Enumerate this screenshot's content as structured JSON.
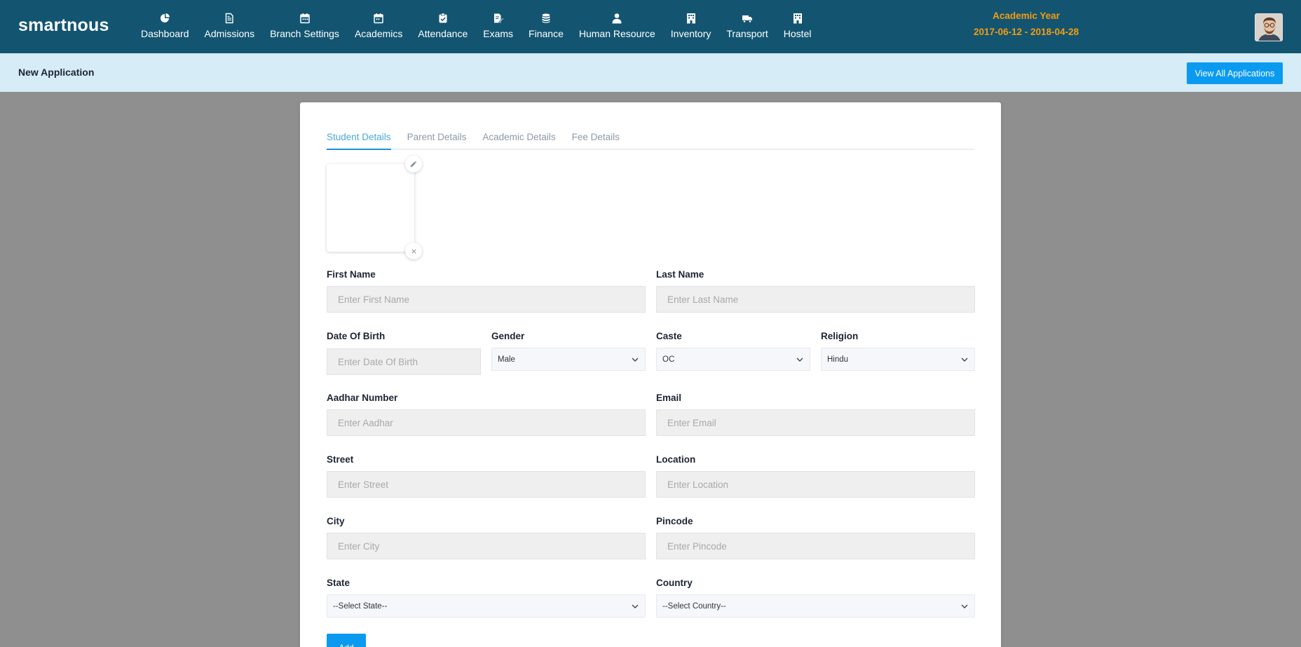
{
  "app": {
    "brand": "smartnous"
  },
  "nav": {
    "items": [
      {
        "label": "Dashboard",
        "icon": "pie-chart-icon"
      },
      {
        "label": "Admissions",
        "icon": "document-icon"
      },
      {
        "label": "Branch Settings",
        "icon": "calendar-icon"
      },
      {
        "label": "Academics",
        "icon": "calendar-icon"
      },
      {
        "label": "Attendance",
        "icon": "clipboard-check-icon"
      },
      {
        "label": "Exams",
        "icon": "edit-document-icon"
      },
      {
        "label": "Finance",
        "icon": "coins-icon"
      },
      {
        "label": "Human Resource",
        "icon": "user-icon"
      },
      {
        "label": "Inventory",
        "icon": "building-icon"
      },
      {
        "label": "Transport",
        "icon": "truck-icon"
      },
      {
        "label": "Hostel",
        "icon": "building-icon"
      }
    ]
  },
  "academic_year": {
    "label": "Academic Year",
    "range": "2017-06-12 - 2018-04-28",
    "color": "#f39c12"
  },
  "subheader": {
    "title": "New Application",
    "view_all_label": "View All Applications"
  },
  "tabs": [
    {
      "label": "Student Details",
      "active": true
    },
    {
      "label": "Parent Details",
      "active": false
    },
    {
      "label": "Academic Details",
      "active": false
    },
    {
      "label": "Fee Details",
      "active": false
    }
  ],
  "form": {
    "first_name": {
      "label": "First Name",
      "placeholder": "Enter First Name"
    },
    "last_name": {
      "label": "Last Name",
      "placeholder": "Enter Last Name"
    },
    "dob": {
      "label": "Date Of Birth",
      "placeholder": "Enter Date Of Birth"
    },
    "gender": {
      "label": "Gender",
      "value": "Male"
    },
    "caste": {
      "label": "Caste",
      "value": "OC"
    },
    "religion": {
      "label": "Religion",
      "value": "Hindu"
    },
    "aadhar": {
      "label": "Aadhar Number",
      "placeholder": "Enter Aadhar"
    },
    "email": {
      "label": "Email",
      "placeholder": "Enter Email"
    },
    "street": {
      "label": "Street",
      "placeholder": "Enter Street"
    },
    "location": {
      "label": "Location",
      "placeholder": "Enter Location"
    },
    "city": {
      "label": "City",
      "placeholder": "Enter City"
    },
    "pincode": {
      "label": "Pincode",
      "placeholder": "Enter Pincode"
    },
    "state": {
      "label": "State",
      "value": "--Select State--"
    },
    "country": {
      "label": "Country",
      "value": "--Select Country--"
    },
    "add_label": "Add"
  },
  "colors": {
    "navbar": "#135571",
    "accent": "#0a9bf0",
    "subheader": "#d6ecf6"
  }
}
